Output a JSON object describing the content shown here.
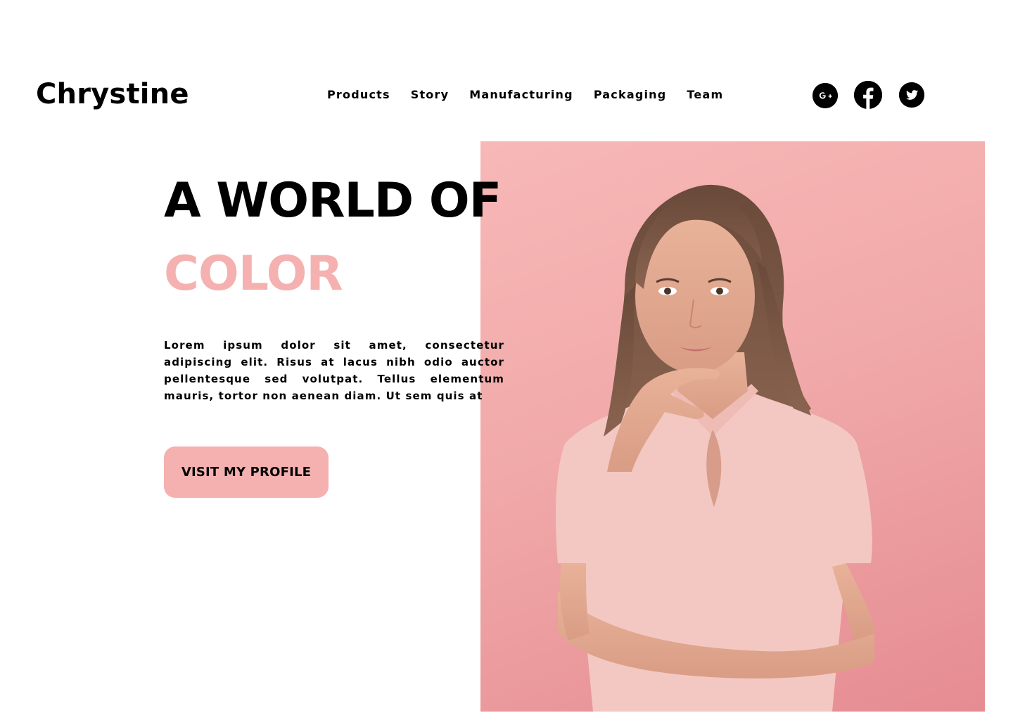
{
  "brand": "Chrystine",
  "nav": {
    "items": [
      "Products",
      "Story",
      "Manufacturing",
      "Packaging",
      "Team"
    ]
  },
  "socials": [
    {
      "icon": "google-plus-icon",
      "glyph": "G+"
    },
    {
      "icon": "facebook-icon",
      "glyph": "f"
    },
    {
      "icon": "twitter-icon",
      "glyph": "t"
    }
  ],
  "hero": {
    "headline_line1": "A WORLD OF",
    "headline_line2": "COLOR",
    "body": "Lorem ipsum dolor sit amet, consectetur adipiscing elit. Risus at lacus nibh odio auctor pellentesque sed volutpat. Tellus elementum mauris, tortor non aenean diam. Ut sem quis at",
    "cta_label": "VISIT MY PROFILE",
    "accent_color": "#f4b1b0",
    "photo_background": "#f1a9a9"
  }
}
